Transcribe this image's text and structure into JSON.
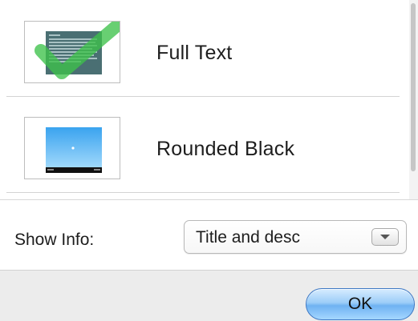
{
  "styles_list": {
    "items": [
      {
        "label": "Full Text",
        "icon": "full-text-thumbnail-icon",
        "selected": true
      },
      {
        "label": "Rounded Black",
        "icon": "rounded-black-thumbnail-icon",
        "selected": false
      }
    ]
  },
  "info": {
    "label": "Show Info:",
    "selected_value": "Title and desc"
  },
  "footer": {
    "ok_label": "OK"
  },
  "colors": {
    "check_green": "#3ec24a",
    "ok_blue": "#6fb2f2",
    "thumb_sky": "#5fb8f0"
  }
}
